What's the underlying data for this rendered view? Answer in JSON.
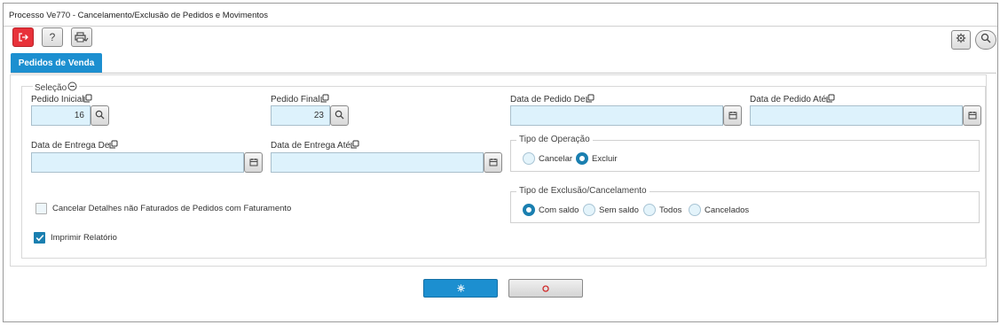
{
  "window": {
    "title": "Processo Ve770 - Cancelamento/Exclusão de Pedidos e Movimentos"
  },
  "toolbar": {
    "exit_icon": "exit-icon",
    "help_label": "?",
    "print_icon": "printer-icon",
    "settings_icon": "gear-icon",
    "search_icon": "search-icon"
  },
  "tabs": [
    {
      "label": "Pedidos de Venda"
    }
  ],
  "selection": {
    "legend": "Seleção",
    "fields": {
      "pedido_inicial": {
        "label": "Pedido Inicial",
        "value": "16"
      },
      "pedido_final": {
        "label": "Pedido Final",
        "value": "23"
      },
      "data_pedido_de": {
        "label": "Data de Pedido De",
        "value": ""
      },
      "data_pedido_ate": {
        "label": "Data de Pedido Até",
        "value": ""
      },
      "data_entrega_de": {
        "label": "Data de Entrega De",
        "value": ""
      },
      "data_entrega_ate": {
        "label": "Data de Entrega Até",
        "value": ""
      }
    },
    "tipo_operacao": {
      "legend": "Tipo de Operação",
      "options": [
        {
          "label": "Cancelar",
          "selected": false
        },
        {
          "label": "Excluir",
          "selected": true
        }
      ]
    },
    "tipo_exclusao": {
      "legend": "Tipo de Exclusão/Cancelamento",
      "options": [
        {
          "label": "Com saldo",
          "selected": true
        },
        {
          "label": "Sem saldo",
          "selected": false
        },
        {
          "label": "Todos",
          "selected": false
        },
        {
          "label": "Cancelados",
          "selected": false
        }
      ]
    },
    "checkboxes": {
      "cancelar_detalhes": {
        "label": "Cancelar Detalhes não Faturados de Pedidos com Faturamento",
        "checked": false
      },
      "imprimir_relatorio": {
        "label": "Imprimir Relatório",
        "checked": true
      }
    }
  },
  "actions": {
    "confirm_icon": "gear-icon",
    "cancel_icon": "circle-icon"
  },
  "colors": {
    "accent": "#1c8fd0",
    "exit": "#e8323a",
    "input_bg": "#ddf2fc"
  }
}
